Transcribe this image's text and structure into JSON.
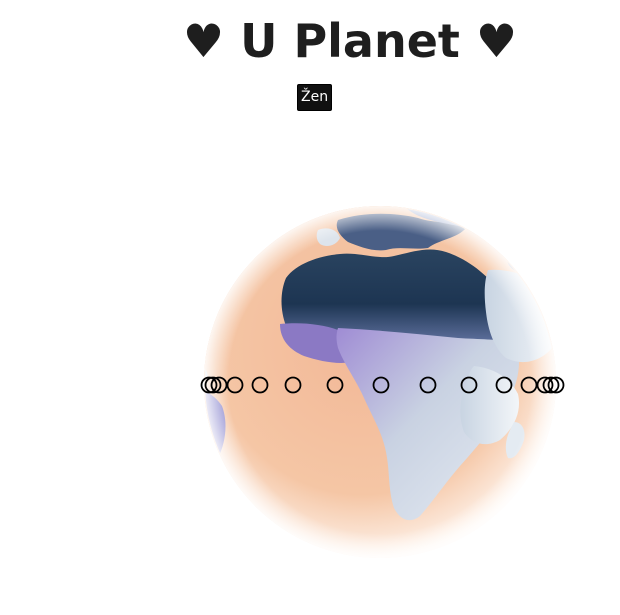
{
  "header": {
    "title": "♥ U Planet ♥"
  },
  "controls": {
    "zen_label": "Žen"
  },
  "colors": {
    "title": "#1e1e1e",
    "zen_background": "#111111",
    "ocean": "#f5c4a2",
    "land_dark": "#1f3650",
    "land_light": "#dfe6ee",
    "land_purple": "#a98ed8"
  },
  "markers": {
    "count": 15,
    "shape": "circle-outline"
  }
}
